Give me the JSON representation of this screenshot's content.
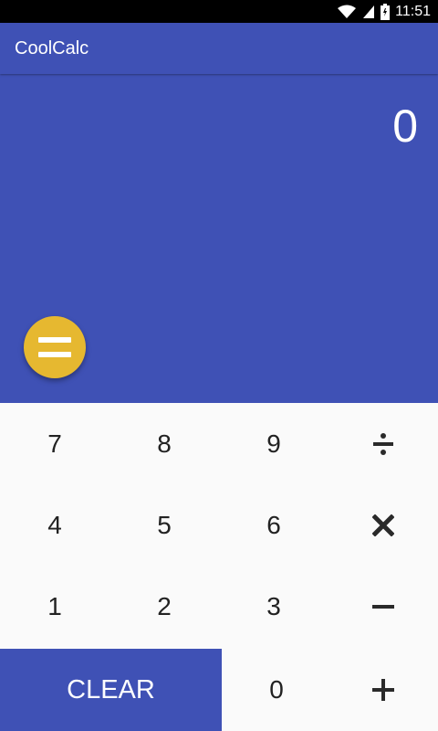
{
  "status_bar": {
    "time": "11:51",
    "icons": [
      "wifi-icon",
      "signal-icon",
      "battery-icon"
    ]
  },
  "app_bar": {
    "title": "CoolCalc"
  },
  "display": {
    "value": "0"
  },
  "fab": {
    "icon": "equals-icon",
    "color": "#e6b830"
  },
  "keypad": {
    "row1": [
      "7",
      "8",
      "9"
    ],
    "row2": [
      "4",
      "5",
      "6"
    ],
    "row3": [
      "1",
      "2",
      "3"
    ],
    "zero": "0",
    "clear": "CLEAR",
    "ops": {
      "divide": "÷",
      "multiply": "×",
      "minus": "−",
      "plus": "+"
    }
  },
  "colors": {
    "primary": "#3f51b5",
    "accent": "#e6b830",
    "keypad_bg": "#fafafa"
  }
}
